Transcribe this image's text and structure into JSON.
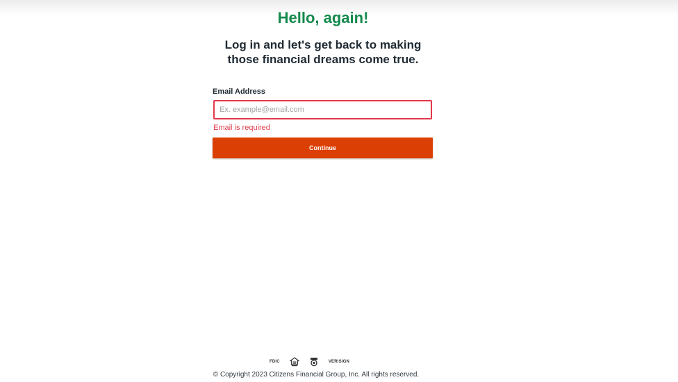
{
  "header": {
    "greeting": "Hello, again!",
    "subtitle_line1": "Log in and let's get back to making",
    "subtitle_line2": "those financial dreams come true."
  },
  "form": {
    "email_label": "Email Address",
    "email_placeholder": "Ex. example@email.com",
    "email_value": "",
    "email_error": "Email is required",
    "continue_label": "Continue"
  },
  "footer": {
    "badges": {
      "fdic": "FDIC",
      "equal_housing": "equal-housing-lender-icon",
      "protection": "security-seal-icon",
      "verisign": "VERISIGN"
    },
    "copyright": "© Copyright 2023 Citizens Financial Group, Inc. All rights reserved."
  },
  "colors": {
    "greeting": "#138a4c",
    "error": "#e2394a",
    "button": "#dc3f03",
    "text": "#1f2a33"
  }
}
